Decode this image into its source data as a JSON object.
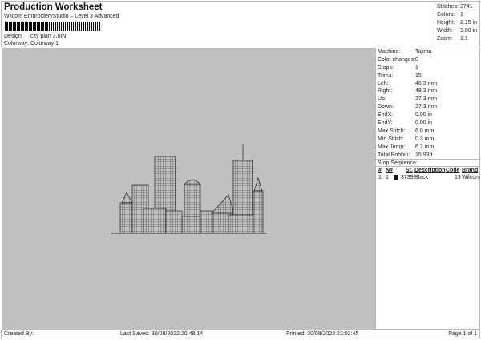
{
  "header": {
    "title": "Production Worksheet",
    "subtitle": "Wilcom EmbroideryStudio – Level 3 Advanced",
    "design_label": "Design:",
    "design": "city plan 3,8IN",
    "colorway_label": "Colorway:",
    "colorway": "Colorway 1"
  },
  "stats": [
    {
      "k": "Stitches:",
      "v": "3741"
    },
    {
      "k": "Colors:",
      "v": "1"
    },
    {
      "k": "Height:",
      "v": "2.15 in"
    },
    {
      "k": "Width:",
      "v": "3.80 in"
    },
    {
      "k": "Zoom:",
      "v": "1:1"
    }
  ],
  "details": [
    {
      "k": "Machine:",
      "v": "Tajima"
    },
    {
      "k": "Color changes:",
      "v": "0"
    },
    {
      "k": "Stops:",
      "v": "1"
    },
    {
      "k": "Trims:",
      "v": "15"
    },
    {
      "k": "Left:",
      "v": "48.3 mm"
    },
    {
      "k": "Right:",
      "v": "48.3 mm"
    },
    {
      "k": "Up:",
      "v": "27.3 mm"
    },
    {
      "k": "Down:",
      "v": "27.3 mm"
    },
    {
      "k": "EndX:",
      "v": "0.00 in"
    },
    {
      "k": "EndY:",
      "v": "0.00 in"
    },
    {
      "k": "Max Stitch:",
      "v": "6.0 mm"
    },
    {
      "k": "Min Stitch:",
      "v": "0.3 mm"
    },
    {
      "k": "Max Jump:",
      "v": "6.2 mm"
    },
    {
      "k": "Total Bobbin:",
      "v": "15.93ft"
    }
  ],
  "stop_sequence": {
    "title": "Stop Sequence:",
    "columns": [
      "#",
      "N#",
      "St.",
      "Description",
      "Code",
      "Brand"
    ],
    "rows": [
      {
        "num": "1.",
        "n": "1",
        "color": "#111111",
        "st": "3739",
        "desc": "Black",
        "code": "13",
        "brand": "Wilcom"
      }
    ]
  },
  "footer": {
    "created": "Created By:",
    "saved": "Last Saved: 30/08/2022 20:48:14",
    "printed": "Printed: 30/08/2022 22:02:45",
    "page": "Page 1 of 1"
  },
  "colors": {
    "canvas": "#c0c0c0",
    "thread": "#111111"
  }
}
